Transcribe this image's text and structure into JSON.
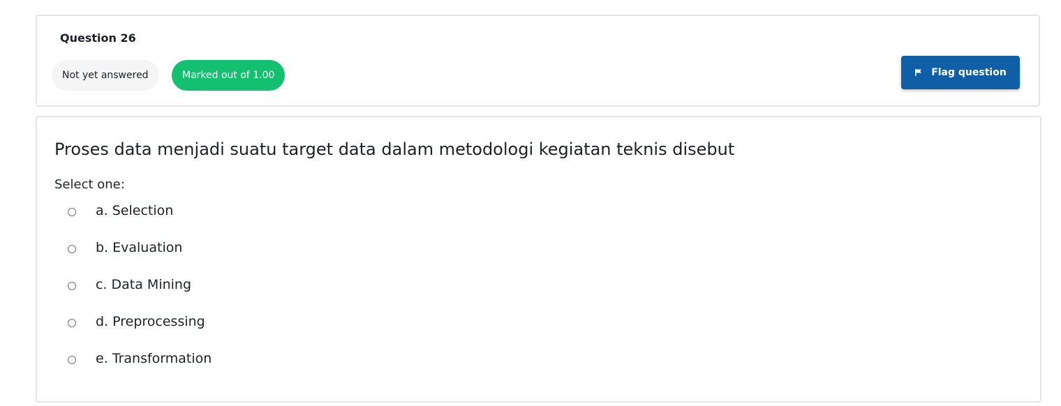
{
  "question_info": {
    "title": "Question 26",
    "status": "Not yet answered",
    "marks": "Marked out of 1.00",
    "flag_label": "Flag question"
  },
  "question": {
    "text": "Proses data menjadi suatu target data dalam metodologi kegiatan teknis disebut",
    "prompt": "Select one:",
    "options": [
      {
        "label": "a. Selection",
        "selected": false
      },
      {
        "label": "b. Evaluation",
        "selected": false
      },
      {
        "label": "c. Data Mining",
        "selected": false
      },
      {
        "label": "d. Preprocessing",
        "selected": false
      },
      {
        "label": "e. Transformation",
        "selected": false
      }
    ]
  },
  "colors": {
    "marks_badge": "#13c06f",
    "flag_button": "#0f5fa6",
    "status_badge": "#f5f5f5"
  },
  "icons": {
    "flag": "flag-icon"
  }
}
